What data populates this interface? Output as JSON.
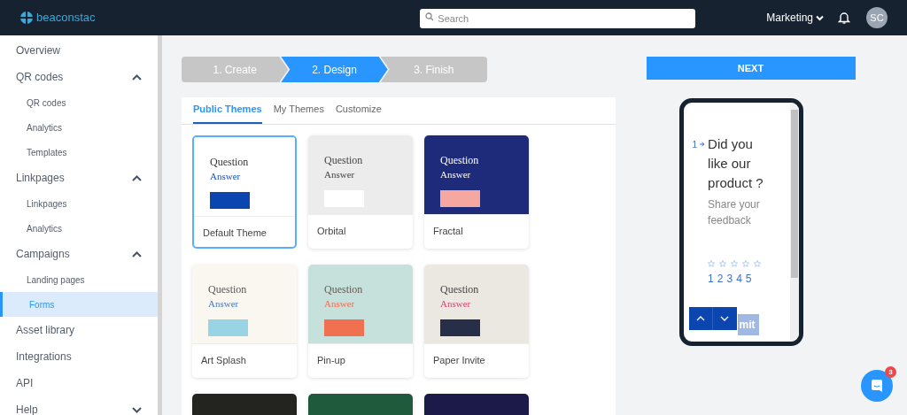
{
  "header": {
    "logo": "beaconstac",
    "search": {
      "placeholder": "Search"
    },
    "workspace": "Marketing",
    "avatar": "SC"
  },
  "sidebar": {
    "items": [
      {
        "label": "Overview",
        "selected": false
      },
      {
        "label": "QR codes",
        "expanded": true,
        "selected": false,
        "children": [
          {
            "label": "QR codes",
            "selected": false
          },
          {
            "label": "Analytics",
            "selected": false
          },
          {
            "label": "Templates",
            "selected": false
          }
        ]
      },
      {
        "label": "Linkpages",
        "expanded": true,
        "selected": false,
        "children": [
          {
            "label": "Linkpages",
            "selected": false
          },
          {
            "label": "Analytics",
            "selected": false
          }
        ]
      },
      {
        "label": "Campaigns",
        "expanded": true,
        "selected": false,
        "children": [
          {
            "label": "Landing pages",
            "selected": false
          },
          {
            "label": "Forms",
            "selected": true
          }
        ]
      },
      {
        "label": "Asset library",
        "selected": false
      },
      {
        "label": "Integrations",
        "selected": false
      },
      {
        "label": "API",
        "selected": false
      },
      {
        "label": "Help",
        "expanded": false,
        "selected": false
      }
    ]
  },
  "steps": [
    {
      "label": "1. Create",
      "selected": false
    },
    {
      "label": "2. Design",
      "selected": true
    },
    {
      "label": "3. Finish",
      "selected": false
    }
  ],
  "next_button": "NEXT",
  "tabs": [
    {
      "label": "Public Themes",
      "selected": true
    },
    {
      "label": "My Themes",
      "selected": false
    },
    {
      "label": "Customize",
      "selected": false
    }
  ],
  "themes": [
    {
      "name": "Default Theme",
      "question": "Question",
      "answer": "Answer",
      "color": "#ffffff",
      "selected": true
    },
    {
      "name": "Orbital",
      "question": "Question",
      "answer": "Answer",
      "color": "#ececec",
      "selected": false
    },
    {
      "name": "Fractal",
      "question": "Question",
      "answer": "Answer",
      "color": "#1e2a7a",
      "selected": false
    },
    {
      "name": "Art Splash",
      "question": "Question",
      "answer": "Answer",
      "color": "#faf7f0",
      "selected": false
    },
    {
      "name": "Pin-up",
      "question": "Question",
      "answer": "Answer",
      "color": "#c6e0dc",
      "selected": false
    },
    {
      "name": "Paper Invite",
      "question": "Question",
      "answer": "Answer",
      "color": "#ebe8e2",
      "selected": false
    },
    {
      "color": "#23231f",
      "selected": false
    },
    {
      "color": "#1f5a3c",
      "selected": false
    },
    {
      "color": "#1b1a48",
      "selected": false
    }
  ],
  "preview": {
    "number": "1",
    "question": "Did you like our product ?",
    "description": "Share your feedback",
    "stars": 0,
    "scale": [
      "1",
      "2",
      "3",
      "4",
      "5"
    ],
    "submit": "mit"
  },
  "chat": {
    "badge": "3"
  }
}
